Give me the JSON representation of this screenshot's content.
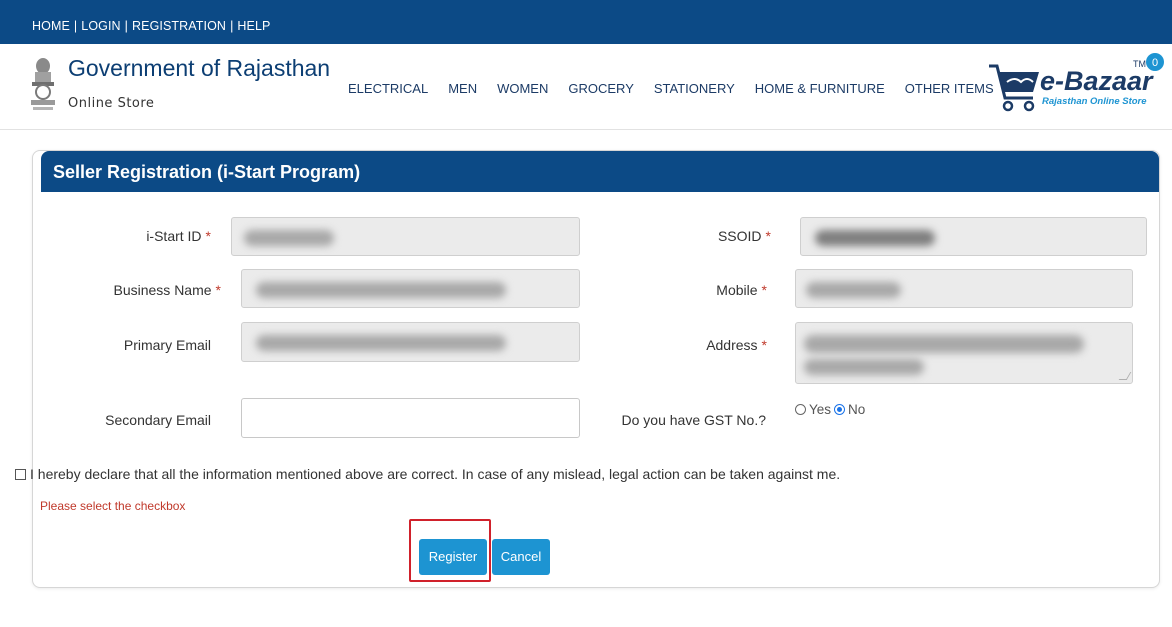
{
  "topbar": {
    "links": [
      "HOME",
      "LOGIN",
      "REGISTRATION",
      "HELP"
    ],
    "separator": "|"
  },
  "header": {
    "brand_title": "Government of Rajasthan",
    "brand_subtitle": "Online Store",
    "nav": [
      "ELECTRICAL",
      "MEN",
      "WOMEN",
      "GROCERY",
      "STATIONERY",
      "HOME & FURNITURE",
      "OTHER ITEMS"
    ],
    "logo": {
      "name": "e-Bazaar",
      "tagline": "Rajasthan Online Store",
      "tm": "TM",
      "cart_count": "0"
    }
  },
  "form": {
    "title": "Seller Registration (i-Start Program)",
    "required_mark": "*",
    "fields": {
      "istart_id": {
        "label": "i-Start ID"
      },
      "ssoid": {
        "label": "SSOID"
      },
      "business_name": {
        "label": "Business Name"
      },
      "mobile": {
        "label": "Mobile"
      },
      "primary_email": {
        "label": "Primary Email"
      },
      "address": {
        "label": "Address"
      },
      "secondary_email": {
        "label": "Secondary Email",
        "value": ""
      },
      "gst": {
        "label": "Do you have GST No.?",
        "options": [
          "Yes",
          "No"
        ],
        "selected": "No"
      }
    },
    "declaration": "I hereby declare that all the information mentioned above are correct. In case of any mislead, legal action can be taken against me.",
    "error": "Please select the checkbox",
    "buttons": {
      "register": "Register",
      "cancel": "Cancel"
    }
  },
  "colors": {
    "primary_blue": "#0c4a86",
    "button_blue": "#1d94d2",
    "error_red": "#c0392b",
    "highlight_red": "#d0212b"
  }
}
